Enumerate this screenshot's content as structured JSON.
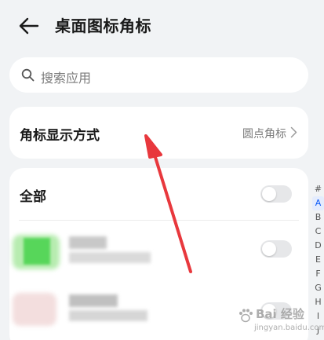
{
  "header": {
    "title": "桌面图标角标",
    "back_icon": "arrow-left-icon"
  },
  "search": {
    "placeholder": "搜索应用",
    "icon": "search-icon"
  },
  "badge_style": {
    "label": "角标显示方式",
    "value": "圆点角标",
    "icon": "chevron-right-icon"
  },
  "app_list": {
    "all_label": "全部",
    "all_toggle_on": false,
    "rows": [
      {
        "name": "",
        "toggle_on": false
      },
      {
        "name": "",
        "toggle_on": false
      }
    ]
  },
  "alpha_index": [
    "#",
    "A",
    "B",
    "C",
    "D",
    "E",
    "F",
    "G",
    "H",
    "I",
    "J"
  ],
  "alpha_index_active": "A",
  "watermark": {
    "main": "Bai 经验",
    "sub": "jingyan.baidu.com"
  },
  "colors": {
    "background": "#f1f3f5",
    "card": "#ffffff",
    "accent": "#0a59f7",
    "annotation_arrow": "#e8383d"
  }
}
